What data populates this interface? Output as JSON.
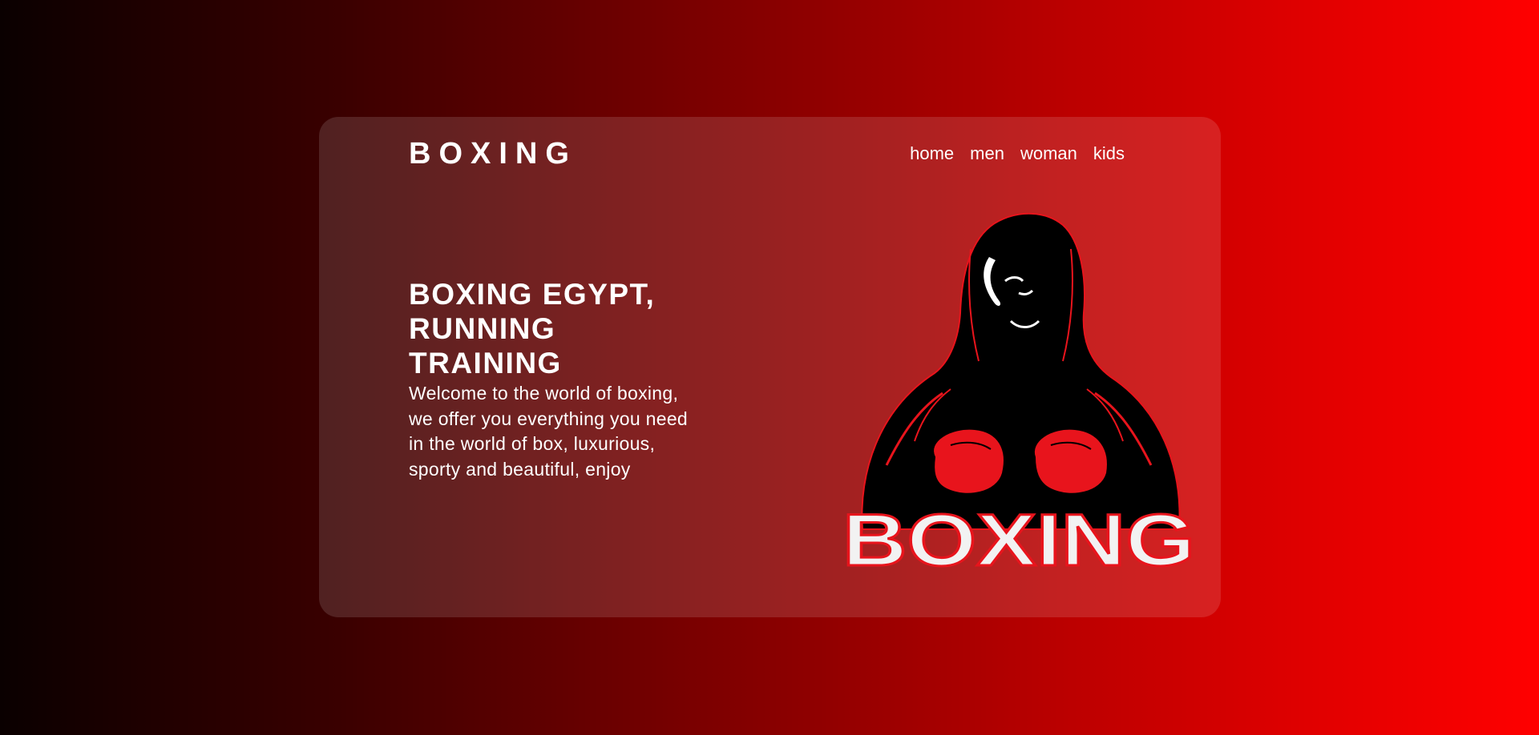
{
  "brand": {
    "logo_text": "BOXING"
  },
  "nav": {
    "items": [
      {
        "label": "home"
      },
      {
        "label": "men"
      },
      {
        "label": "woman"
      },
      {
        "label": "kids"
      }
    ]
  },
  "hero": {
    "headline": "BOXING EGYPT, RUNNING TRAINING",
    "description": "Welcome to the world of boxing, we offer you everything you need in the world of box, luxurious, sporty and beautiful, enjoy",
    "image_text": "BOXING"
  },
  "colors": {
    "background_start": "#0a0000",
    "background_end": "#ff0000",
    "accent_red": "#e8141c",
    "text": "#ffffff"
  }
}
